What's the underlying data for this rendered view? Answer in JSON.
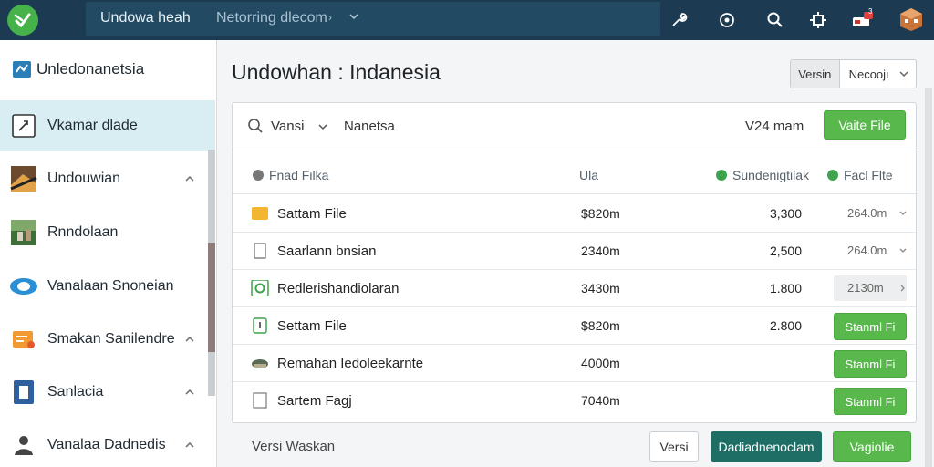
{
  "topbar": {
    "title": "Undowa heah",
    "crumb": "Netorring dlecom",
    "crumb_sep": "›",
    "icons": [
      "wrench-icon",
      "settings-circle-icon",
      "search-icon",
      "gear-icon",
      "notification-icon",
      "profile-box-icon"
    ],
    "badge": "3"
  },
  "sidebar": {
    "items": [
      {
        "label": "Unledonanetsia",
        "icon": "app-icon",
        "chevron": false
      },
      {
        "label": "Vkamar dlade",
        "icon": "edit-icon",
        "chevron": false,
        "active": true
      },
      {
        "label": "Undouwian",
        "icon": "photo-icon",
        "chevron": true
      },
      {
        "label": "Rnndolaan",
        "icon": "landscape-icon",
        "chevron": false
      },
      {
        "label": "Vanalaan Snoneian",
        "icon": "eye-icon",
        "chevron": false
      },
      {
        "label": "Smakan Sanilendre",
        "icon": "list-icon",
        "chevron": true
      },
      {
        "label": "Sanlacia",
        "icon": "document-icon",
        "chevron": true
      },
      {
        "label": "Vanalaa Dadnedis",
        "icon": "user-icon",
        "chevron": true
      }
    ]
  },
  "main": {
    "title": "Undowhan : Indanesia",
    "seg_a": "Versin",
    "seg_b": "Necoojı",
    "toolbar": {
      "filter": "Vansi",
      "name": "Nanetsa",
      "count": "V24 mam",
      "primary_button": "Vaite File"
    },
    "table": {
      "headers": [
        "Fnad Filka",
        "Ula",
        "Sundenigtilak",
        "Facl Flte"
      ],
      "rows": [
        {
          "name": "Sattam File",
          "size": "$820m",
          "count": "3,300",
          "version": "264.0m",
          "action": null
        },
        {
          "name": "Saarlann bnsian",
          "size": "2340m",
          "count": "2,500",
          "version": "264.0m",
          "action": null
        },
        {
          "name": "Redlerishandiolaran",
          "size": "3430m",
          "count": "1.800",
          "version": "2130m",
          "action": null
        },
        {
          "name": "Settam File",
          "size": "$820m",
          "count": "2.800",
          "version": null,
          "action": "Stanml Fi"
        },
        {
          "name": "Remahan Iedoleekarnte",
          "size": "4000m",
          "count": "",
          "version": null,
          "action": "Stanml Fi"
        },
        {
          "name": "Sartem Fagj",
          "size": "7040m",
          "count": "",
          "version": null,
          "action": "Stanml Fi"
        }
      ]
    },
    "footer": {
      "text": "Versi Waskan",
      "outline_button": "Versi",
      "teal_button": "Dadiadnenoclam",
      "apply_button": "Vagiolie"
    }
  },
  "colors": {
    "topbar": "#1c3b52",
    "accent_green": "#58b84c",
    "teal": "#1f6e66",
    "active_bg": "#d9eef3"
  }
}
